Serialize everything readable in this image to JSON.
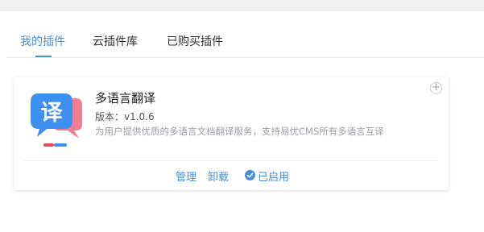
{
  "tabs": [
    {
      "label": "我的插件",
      "active": true
    },
    {
      "label": "云插件库",
      "active": false
    },
    {
      "label": "已购买插件",
      "active": false
    }
  ],
  "plugin": {
    "logo_char": "译",
    "title": "多语言翻译",
    "version": "版本：v1.0.6",
    "description": "为用户提供优质的多语言文档翻译服务，支持易优CMS所有多语言互译",
    "add_label": "+",
    "actions": {
      "manage": "管理",
      "uninstall": "卸载",
      "enabled": "已启用"
    }
  },
  "colors": {
    "accent": "#4a8fd4",
    "logo_blue": "#3d8ff0",
    "logo_pink": "#f07f93"
  },
  "icons": [
    "plus-icon",
    "translate-logo-icon",
    "check-circle-icon"
  ]
}
